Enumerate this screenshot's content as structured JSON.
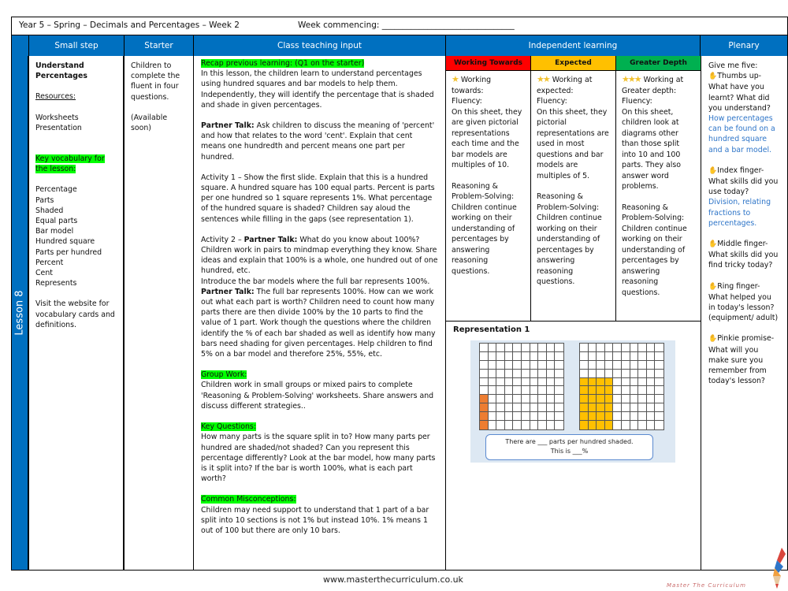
{
  "header": {
    "title": "Year 5 – Spring – Decimals and Percentages – Week 2",
    "week_commencing_label": "Week commencing: ________________________________",
    "columns": [
      "Small step",
      "Starter",
      "Class teaching input",
      "Independent learning",
      "Plenary"
    ]
  },
  "lesson_label": "Lesson 8",
  "small_step": {
    "title_line1": "Understand",
    "title_line2": "Percentages",
    "resources_label": "Resources:",
    "resources": [
      "Worksheets",
      "Presentation"
    ],
    "vocab_label_line1": "Key vocabulary for",
    "vocab_label_line2": "the lesson:",
    "vocabulary": [
      "Percentage",
      "Parts",
      "Shaded",
      "Equal parts",
      "Bar model",
      "Hundred square",
      "Parts per hundred",
      "Percent",
      "Cent",
      "Represents"
    ],
    "website_note": "Visit the website for vocabulary cards and definitions."
  },
  "starter": {
    "text": "Children to complete the fluent in four questions.",
    "availability": "(Available soon)"
  },
  "teaching": {
    "recap_heading": "Recap previous learning: (Q1 on the starter)",
    "recap_text": "In this lesson, the children learn to understand percentages using hundred squares and bar models to help them. Independently, they will identify the percentage that is shaded and shade in given percentages.",
    "partner_talk_label": "Partner Talk:",
    "partner_talk_1": " Ask children to discuss the meaning of 'percent' and how that relates to the word 'cent'. Explain that cent means one hundredth and percent means one part per hundred.",
    "activity1": "Activity 1 – Show the first slide. Explain that this is a hundred square. A hundred square has 100 equal parts. Percent is parts per one hundred so 1 square represents 1%. What percentage of the hundred square is shaded? Children say aloud the sentences while filling in the gaps (see representation 1).",
    "activity2_prefix": "Activity 2 – ",
    "activity2_text": " What do you know about 100%? Children work in pairs to mindmap everything they know. Share ideas and explain that 100% is a whole, one hundred out of one hundred, etc.",
    "bar_intro": "Introduce the bar models where the full bar represents 100%.",
    "partner_talk_2": " The full bar represents 100%. How can we work out what each part is worth? Children need to count how many parts there are then divide 100% by the 10 parts to find the value of 1 part. Work though the questions where the children identify the % of each bar shaded as well as identify how many bars need shading for given percentages. Help children to find 5% on a bar model and therefore 25%, 55%, etc.",
    "group_work_heading": "Group Work:",
    "group_work_text": "Children work in small groups or mixed pairs to complete 'Reasoning & Problem-Solving' worksheets. Share answers and discuss different strategies..",
    "key_questions_heading": "Key Questions:",
    "key_questions_text": "How many parts is the square split in to? How many parts per hundred are shaded/not shaded? Can you represent this percentage differently? Look at the bar model, how many parts is it split into? If the bar is worth 100%, what is each part worth?",
    "misconceptions_heading": "Common Misconceptions:",
    "misconceptions_text": "Children may need support to understand that 1 part of a bar split into 10 sections is not 1% but instead 10%. 1% means 1 out of 100 but there are only 10 bars."
  },
  "independent": {
    "levels": [
      {
        "label": "Working Towards",
        "color": "#ff0000",
        "stars": "★",
        "intro": "Working towards:",
        "fluency_label": "Fluency:",
        "fluency": "On this sheet, they are given pictorial representations each time and the bar models are multiples of 10.",
        "rps_label": "Reasoning & Problem-Solving:",
        "rps": "Children continue working on their understanding of percentages by answering reasoning questions."
      },
      {
        "label": "Expected",
        "color": "#ffc000",
        "stars": "★★",
        "intro": "Working at expected:",
        "fluency_label": "Fluency:",
        "fluency": "On this sheet, they pictorial representations are used in most questions and bar models are multiples of 5.",
        "rps_label": "Reasoning & Problem-Solving:",
        "rps": "Children continue working on their understanding of percentages by answering reasoning questions."
      },
      {
        "label": "Greater Depth",
        "color": "#00b050",
        "stars": "★★★",
        "intro": "Working at Greater depth:",
        "fluency_label": "Fluency:",
        "fluency": "On this sheet, children look at diagrams other than those split into 10 and 100 parts. They also answer word problems.",
        "rps_label": "Reasoning & Problem-Solving:",
        "rps": "Children continue working on their understanding of percentages by answering reasoning questions."
      }
    ],
    "representation": {
      "title": "Representation 1",
      "grids": [
        {
          "shaded_color": "#ed7d31",
          "shaded_columns": [
            1
          ],
          "shaded_rows": [
            7,
            8,
            9,
            10
          ]
        },
        {
          "shaded_color": "#ffc000",
          "shaded_columns": [
            1,
            2,
            3,
            4
          ],
          "shaded_rows": [
            5,
            6,
            7,
            8,
            9,
            10
          ]
        }
      ],
      "sentence_line1": "There are ___ parts per hundred shaded.",
      "sentence_line2": "This is ___%"
    }
  },
  "plenary": {
    "intro": "Give me five:",
    "items": [
      {
        "icon": "hand-icon",
        "prompt": "Thumbs up- What have you learnt? What did you understand?",
        "answer": "How percentages can be found on a hundred square and a bar model."
      },
      {
        "icon": "hand-icon",
        "prompt": "Index finger- What skills did you use today?",
        "answer": "Division, relating fractions to percentages."
      },
      {
        "icon": "hand-icon",
        "prompt": "Middle finger- What skills did you find tricky today?",
        "answer": ""
      },
      {
        "icon": "hand-icon",
        "prompt": "Ring finger- What helped you in today's lesson? (equipment/ adult)",
        "answer": ""
      },
      {
        "icon": "hand-icon",
        "prompt": "Pinkie promise- What will you make sure you remember from today's lesson?",
        "answer": ""
      }
    ]
  },
  "footer": {
    "url": "www.masterthecurriculum.co.uk",
    "brand": "Master The Curriculum"
  }
}
